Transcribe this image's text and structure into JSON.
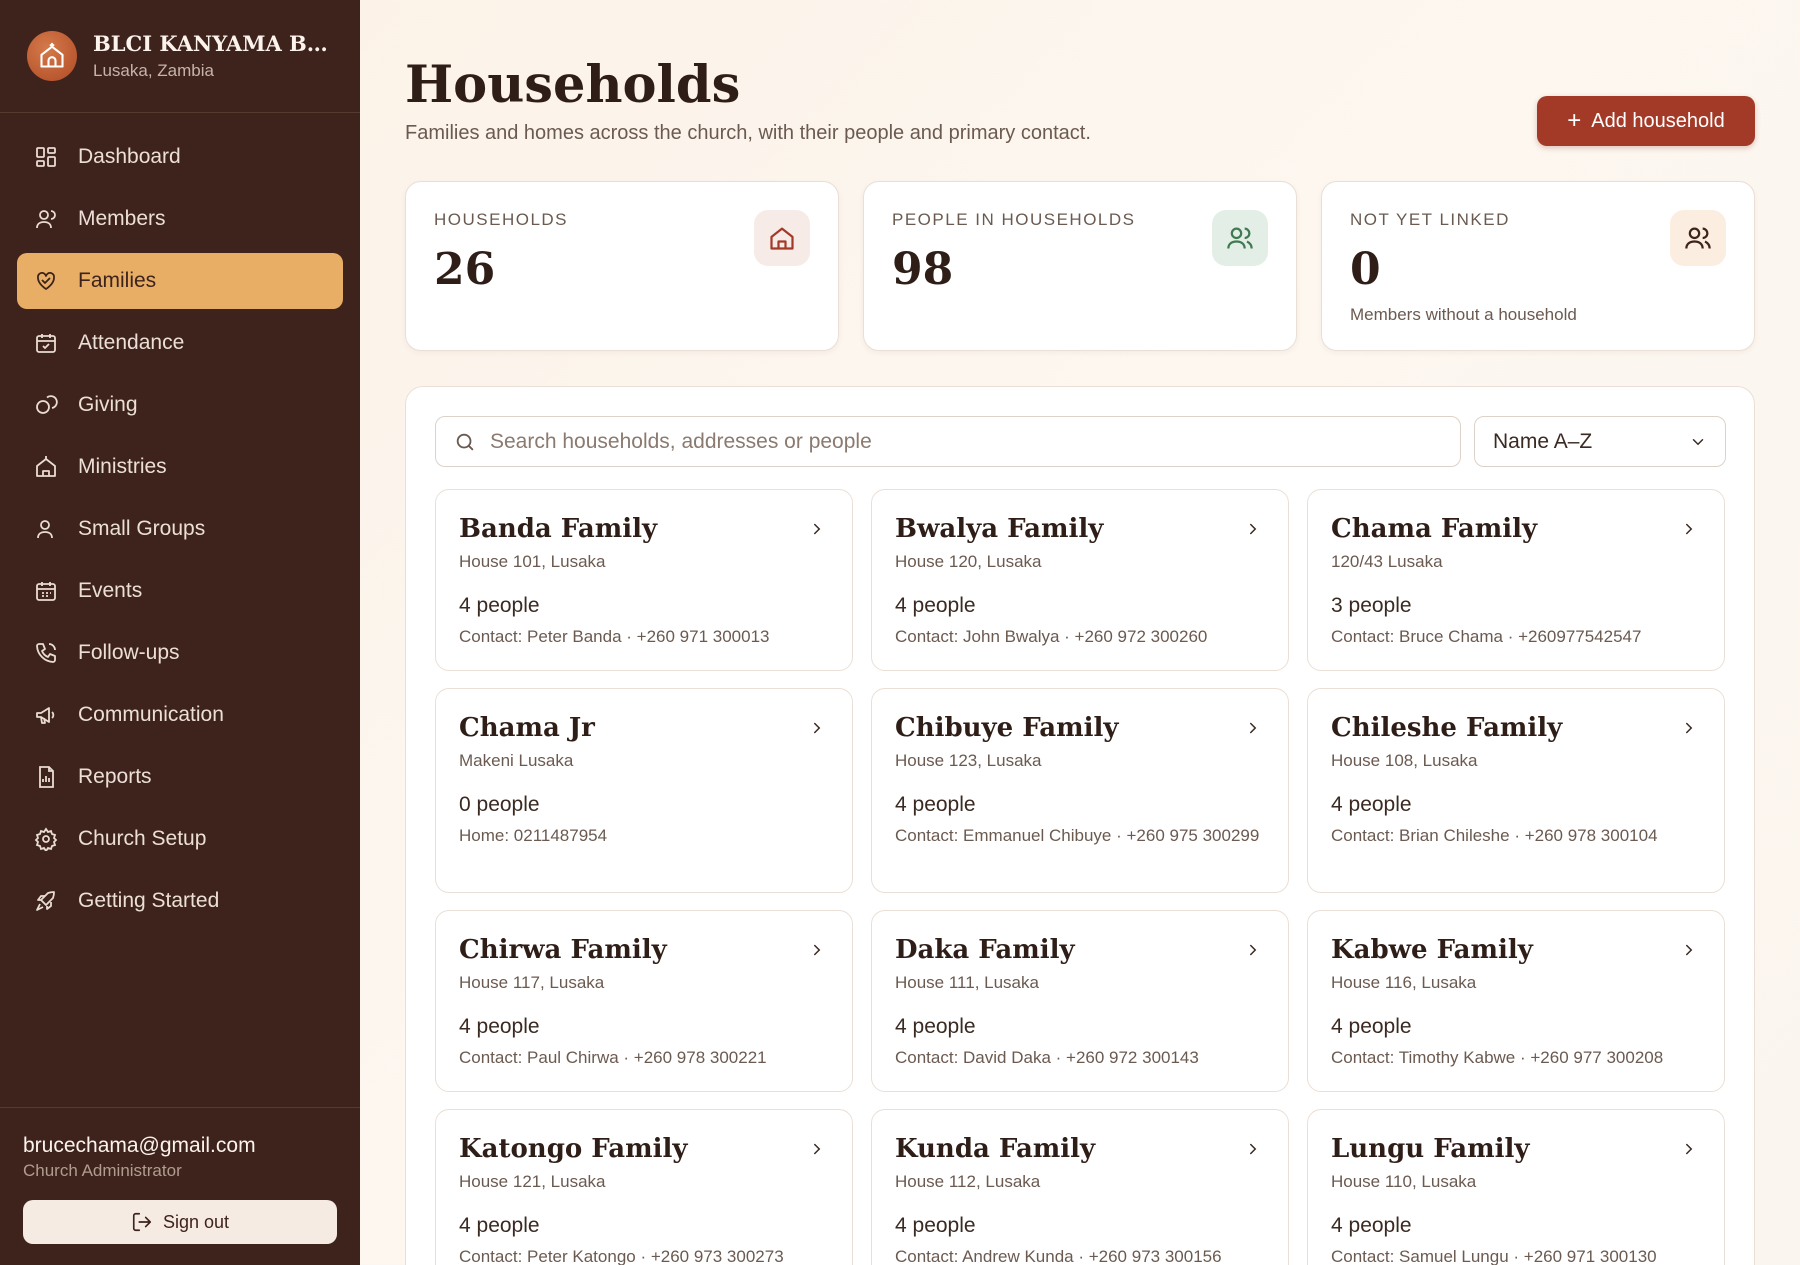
{
  "brand": {
    "name": "BLCI KANYAMA BR...",
    "location": "Lusaka, Zambia"
  },
  "nav": [
    {
      "label": "Dashboard",
      "icon": "dashboard-icon"
    },
    {
      "label": "Members",
      "icon": "user-icon"
    },
    {
      "label": "Families",
      "icon": "heart-hands-icon",
      "active": true
    },
    {
      "label": "Attendance",
      "icon": "calendar-check-icon"
    },
    {
      "label": "Giving",
      "icon": "coins-icon"
    },
    {
      "label": "Ministries",
      "icon": "church-icon"
    },
    {
      "label": "Small Groups",
      "icon": "users-icon"
    },
    {
      "label": "Events",
      "icon": "calendar-icon"
    },
    {
      "label": "Follow-ups",
      "icon": "phone-icon"
    },
    {
      "label": "Communication",
      "icon": "megaphone-icon"
    },
    {
      "label": "Reports",
      "icon": "report-icon"
    },
    {
      "label": "Church Setup",
      "icon": "gear-icon"
    },
    {
      "label": "Getting Started",
      "icon": "rocket-icon"
    }
  ],
  "user": {
    "email": "brucechama@gmail.com",
    "role": "Church Administrator",
    "signout_label": "Sign out"
  },
  "header": {
    "title": "Households",
    "subtitle": "Families and homes across the church, with their people and primary contact.",
    "add_label": "Add household"
  },
  "stats": [
    {
      "label": "HOUSEHOLDS",
      "value": "26",
      "note": "",
      "icon": "home-icon",
      "icon_bg": "#f6ebe7",
      "icon_color": "#a33a28"
    },
    {
      "label": "PEOPLE IN HOUSEHOLDS",
      "value": "98",
      "note": "",
      "icon": "users-icon",
      "icon_bg": "#e3efe6",
      "icon_color": "#3f7a52"
    },
    {
      "label": "NOT YET LINKED",
      "value": "0",
      "note": "Members without a household",
      "icon": "users-icon",
      "icon_bg": "#fbeee0",
      "icon_color": "#3d231c"
    }
  ],
  "search": {
    "placeholder": "Search households, addresses or people"
  },
  "sort": {
    "selected": "Name A–Z"
  },
  "households": [
    {
      "name": "Banda Family",
      "address": "House 101, Lusaka",
      "people": "4 people",
      "contact": "Contact: Peter Banda · +260 971 300013"
    },
    {
      "name": "Bwalya Family",
      "address": "House 120, Lusaka",
      "people": "4 people",
      "contact": "Contact: John Bwalya · +260 972 300260"
    },
    {
      "name": "Chama Family",
      "address": "120/43 Lusaka",
      "people": "3 people",
      "contact": "Contact: Bruce Chama · +260977542547"
    },
    {
      "name": "Chama Jr",
      "address": "Makeni Lusaka",
      "people": "0 people",
      "contact": "Home: 0211487954"
    },
    {
      "name": "Chibuye Family",
      "address": "House 123, Lusaka",
      "people": "4 people",
      "contact": "Contact: Emmanuel Chibuye · +260 975 300299"
    },
    {
      "name": "Chileshe Family",
      "address": "House 108, Lusaka",
      "people": "4 people",
      "contact": "Contact: Brian Chileshe · +260 978 300104"
    },
    {
      "name": "Chirwa Family",
      "address": "House 117, Lusaka",
      "people": "4 people",
      "contact": "Contact: Paul Chirwa · +260 978 300221"
    },
    {
      "name": "Daka Family",
      "address": "House 111, Lusaka",
      "people": "4 people",
      "contact": "Contact: David Daka · +260 972 300143"
    },
    {
      "name": "Kabwe Family",
      "address": "House 116, Lusaka",
      "people": "4 people",
      "contact": "Contact: Timothy Kabwe · +260 977 300208"
    },
    {
      "name": "Katongo Family",
      "address": "House 121, Lusaka",
      "people": "4 people",
      "contact": "Contact: Peter Katongo · +260 973 300273"
    },
    {
      "name": "Kunda Family",
      "address": "House 112, Lusaka",
      "people": "4 people",
      "contact": "Contact: Andrew Kunda · +260 973 300156"
    },
    {
      "name": "Lungu Family",
      "address": "House 110, Lusaka",
      "people": "4 people",
      "contact": "Contact: Samuel Lungu · +260 971 300130"
    }
  ]
}
